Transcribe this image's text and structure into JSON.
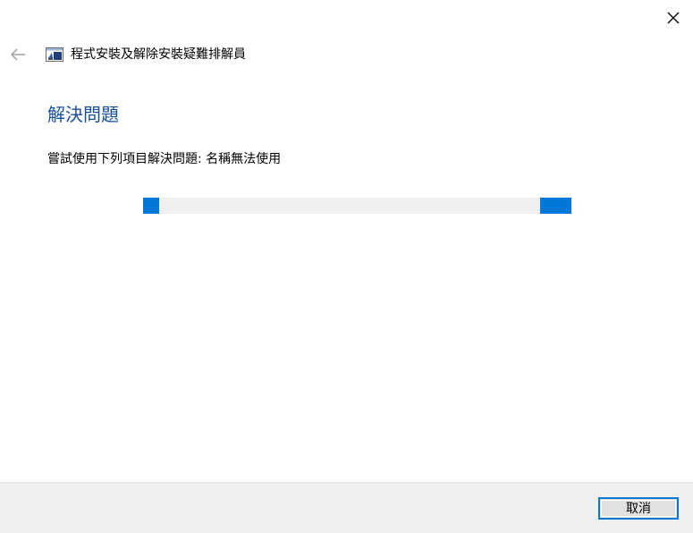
{
  "window": {
    "title": "程式安裝及解除安裝疑難排解員",
    "close_icon": "close-icon",
    "back_icon": "back-arrow-icon",
    "app_icon": "troubleshooter-app-icon"
  },
  "main": {
    "heading": "解決問題",
    "status": "嘗試使用下列項目解決問題: 名稱無法使用",
    "progress": {
      "mode": "indeterminate",
      "color": "#0078d7",
      "track_color": "#efefef"
    }
  },
  "footer": {
    "cancel_label": "取消"
  },
  "colors": {
    "heading": "#1a4f9c",
    "accent": "#0078d7",
    "footer_bg": "#f0f0f0"
  }
}
